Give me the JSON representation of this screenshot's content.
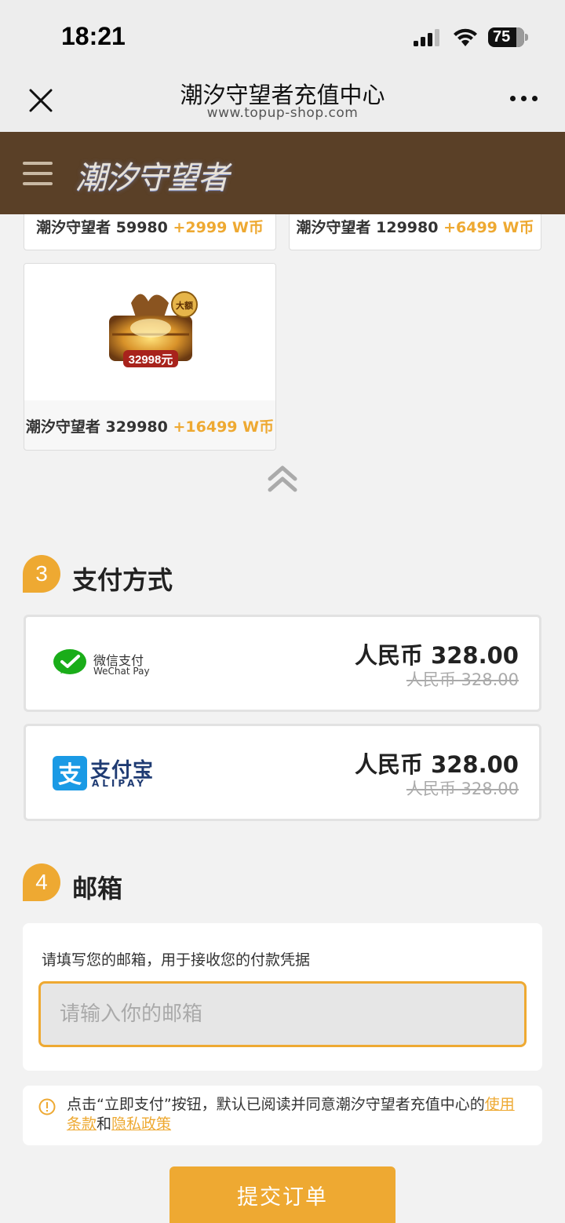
{
  "status_bar": {
    "time": "18:21",
    "battery": "75"
  },
  "nav": {
    "title": "潮汐守望者充值中心",
    "url": "www.topup-shop.com"
  },
  "site": {
    "logo_text": "潮汐守望者"
  },
  "products": [
    {
      "name": "潮汐守望者 59980",
      "bonus": "+2999 W币"
    },
    {
      "name": "潮汐守望者 129980",
      "bonus": "+6499 W币"
    },
    {
      "name": "潮汐守望者 329980",
      "bonus": "+16499 W币",
      "badge": "大额",
      "price_tag": "32998元"
    }
  ],
  "payment_section": {
    "step": "3",
    "title": "支付方式"
  },
  "payments": [
    {
      "brand_cn": "微信支付",
      "brand_en": "WeChat Pay",
      "price": "人民币 328.00",
      "original_price": "人民币 328.00",
      "color": "#1aad19"
    },
    {
      "brand_cn": "支付宝",
      "brand_en": "ALIPAY",
      "price": "人民币 328.00",
      "original_price": "人民币 328.00",
      "color": "#1a9ae5"
    }
  ],
  "email_section": {
    "step": "4",
    "title": "邮箱",
    "hint": "请填写您的邮箱，用于接收您的付款凭据",
    "placeholder": "请输入你的邮箱"
  },
  "notice": {
    "text_before": "点击“立即支付”按钮，默认已阅读并同意潮汐守望者充值中心的",
    "terms_link": "使用条款",
    "connector": "和",
    "privacy_link": "隐私政策"
  },
  "submit": {
    "label": "提交订单"
  },
  "colors": {
    "accent": "#eea932",
    "header_bg": "#5a4027"
  }
}
